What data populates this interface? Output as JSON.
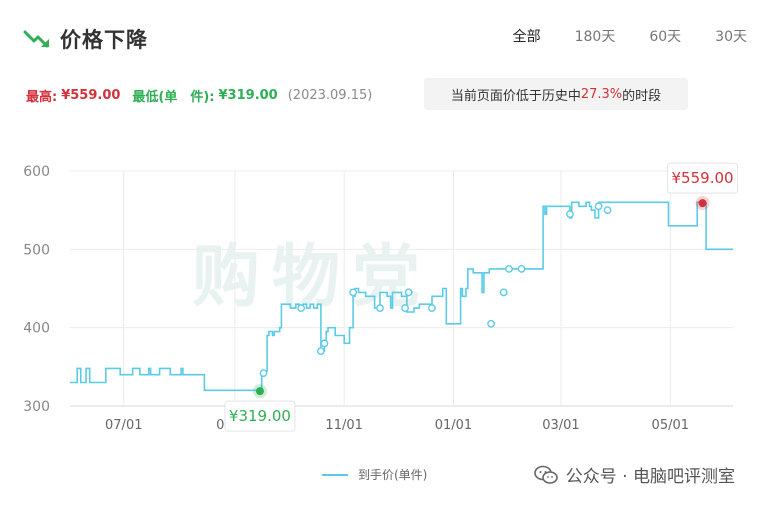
{
  "header": {
    "title": "价格下降",
    "trend_icon": "price-down-arrow-icon"
  },
  "tabs": [
    "全部",
    "180天",
    "60天",
    "30天"
  ],
  "stats": {
    "high_label": "最高:",
    "high_value": "¥559.00",
    "low_label": "最低(单　件):",
    "low_value": "¥319.00",
    "low_date": "(2023.09.15)"
  },
  "notice": {
    "prefix": "当前页面价低于历史中",
    "percent": "27.3%",
    "suffix": "的时段"
  },
  "colors": {
    "line": "#5bcbe7",
    "high": "#d4313a",
    "low": "#2faf55",
    "grid": "#ececec"
  },
  "chart_data": {
    "type": "line",
    "ylim": [
      300,
      600
    ],
    "yticks": [
      300,
      400,
      500,
      600
    ],
    "xticks": [
      "07/01",
      "09/01",
      "11/01",
      "01/01",
      "03/01",
      "05/01"
    ],
    "grid": true,
    "legend_placement": "bottom",
    "series": [
      {
        "name": "到手价(单件)",
        "x": [
          "2023-06-01",
          "2023-06-04",
          "2023-06-05",
          "2023-06-07",
          "2023-06-09",
          "2023-06-10",
          "2023-06-12",
          "2023-06-20",
          "2023-06-21",
          "2023-06-28",
          "2023-06-29",
          "2023-07-05",
          "2023-07-06",
          "2023-07-10",
          "2023-07-11",
          "2023-07-15",
          "2023-07-16",
          "2023-07-20",
          "2023-07-21",
          "2023-07-27",
          "2023-07-28",
          "2023-08-02",
          "2023-08-03",
          "2023-08-14",
          "2023-08-15",
          "2023-08-16",
          "2023-09-15",
          "2023-09-16",
          "2023-09-18",
          "2023-09-19",
          "2023-09-20",
          "2023-09-22",
          "2023-09-23",
          "2023-09-26",
          "2023-09-27",
          "2023-10-01",
          "2023-10-02",
          "2023-10-05",
          "2023-10-07",
          "2023-10-09",
          "2023-10-11",
          "2023-10-13",
          "2023-10-15",
          "2023-10-17",
          "2023-10-19",
          "2023-10-21",
          "2023-10-22",
          "2023-10-23",
          "2023-10-25",
          "2023-10-27",
          "2023-11-01",
          "2023-11-03",
          "2023-11-04",
          "2023-11-06",
          "2023-11-07",
          "2023-11-09",
          "2023-11-11",
          "2023-11-13",
          "2023-11-17",
          "2023-11-18",
          "2023-11-21",
          "2023-11-25",
          "2023-11-27",
          "2023-11-28",
          "2023-12-01",
          "2023-12-03",
          "2023-12-05",
          "2023-12-06",
          "2023-12-07",
          "2023-12-10",
          "2023-12-12",
          "2023-12-13",
          "2023-12-20",
          "2023-12-25",
          "2023-12-26",
          "2023-12-28",
          "2024-01-01",
          "2024-01-05",
          "2024-01-06",
          "2024-01-08",
          "2024-01-09",
          "2024-01-11",
          "2024-01-12",
          "2024-01-14",
          "2024-01-15",
          "2024-01-17",
          "2024-01-18",
          "2024-01-19",
          "2024-01-21",
          "2024-01-22",
          "2024-01-25",
          "2024-01-27",
          "2024-01-29",
          "2024-02-01",
          "2024-02-04",
          "2024-02-08",
          "2024-02-17",
          "2024-02-20",
          "2024-02-21",
          "2024-02-22",
          "2024-02-26",
          "2024-03-04",
          "2024-03-05",
          "2024-03-06",
          "2024-03-07",
          "2024-03-09",
          "2024-03-11",
          "2024-03-13",
          "2024-03-15",
          "2024-03-17",
          "2024-03-18",
          "2024-03-20",
          "2024-03-22",
          "2024-03-27",
          "2024-03-28",
          "2024-03-29",
          "2024-04-03",
          "2024-04-29",
          "2024-04-30",
          "2024-05-01",
          "2024-05-15",
          "2024-05-16",
          "2024-05-18",
          "2024-05-19",
          "2024-05-20",
          "2024-05-21",
          "2024-05-22",
          "2024-05-23",
          "2024-06-05"
        ],
        "values": [
          330,
          330,
          348,
          330,
          330,
          348,
          330,
          330,
          348,
          348,
          340,
          340,
          348,
          340,
          340,
          348,
          340,
          340,
          348,
          340,
          340,
          348,
          340,
          340,
          320,
          320,
          320,
          345,
          345,
          390,
          395,
          390,
          395,
          400,
          430,
          430,
          425,
          430,
          425,
          430,
          425,
          430,
          425,
          430,
          370,
          380,
          395,
          400,
          400,
          390,
          380,
          380,
          400,
          440,
          450,
          445,
          445,
          440,
          440,
          425,
          445,
          440,
          425,
          445,
          445,
          440,
          440,
          420,
          420,
          425,
          425,
          430,
          440,
          440,
          450,
          405,
          405,
          450,
          440,
          450,
          475,
          475,
          470,
          470,
          470,
          445,
          470,
          470,
          475,
          475,
          475,
          475,
          475,
          475,
          475,
          475,
          475,
          555,
          545,
          555,
          555,
          555,
          555,
          540,
          560,
          560,
          555,
          555,
          560,
          555,
          550,
          540,
          560,
          560,
          560,
          560,
          560,
          560,
          530,
          530,
          530,
          560,
          560,
          560,
          559,
          500,
          500,
          500,
          500
        ]
      }
    ],
    "markers": [
      {
        "label": "¥559.00",
        "kind": "high",
        "x": "2024-05-19",
        "y": 559
      },
      {
        "label": "¥319.00",
        "kind": "low",
        "x": "2023-09-15",
        "y": 319
      }
    ]
  },
  "watermark": {
    "text": "公众号 · 电脑吧评测室"
  },
  "chart_watermark": "购物党"
}
